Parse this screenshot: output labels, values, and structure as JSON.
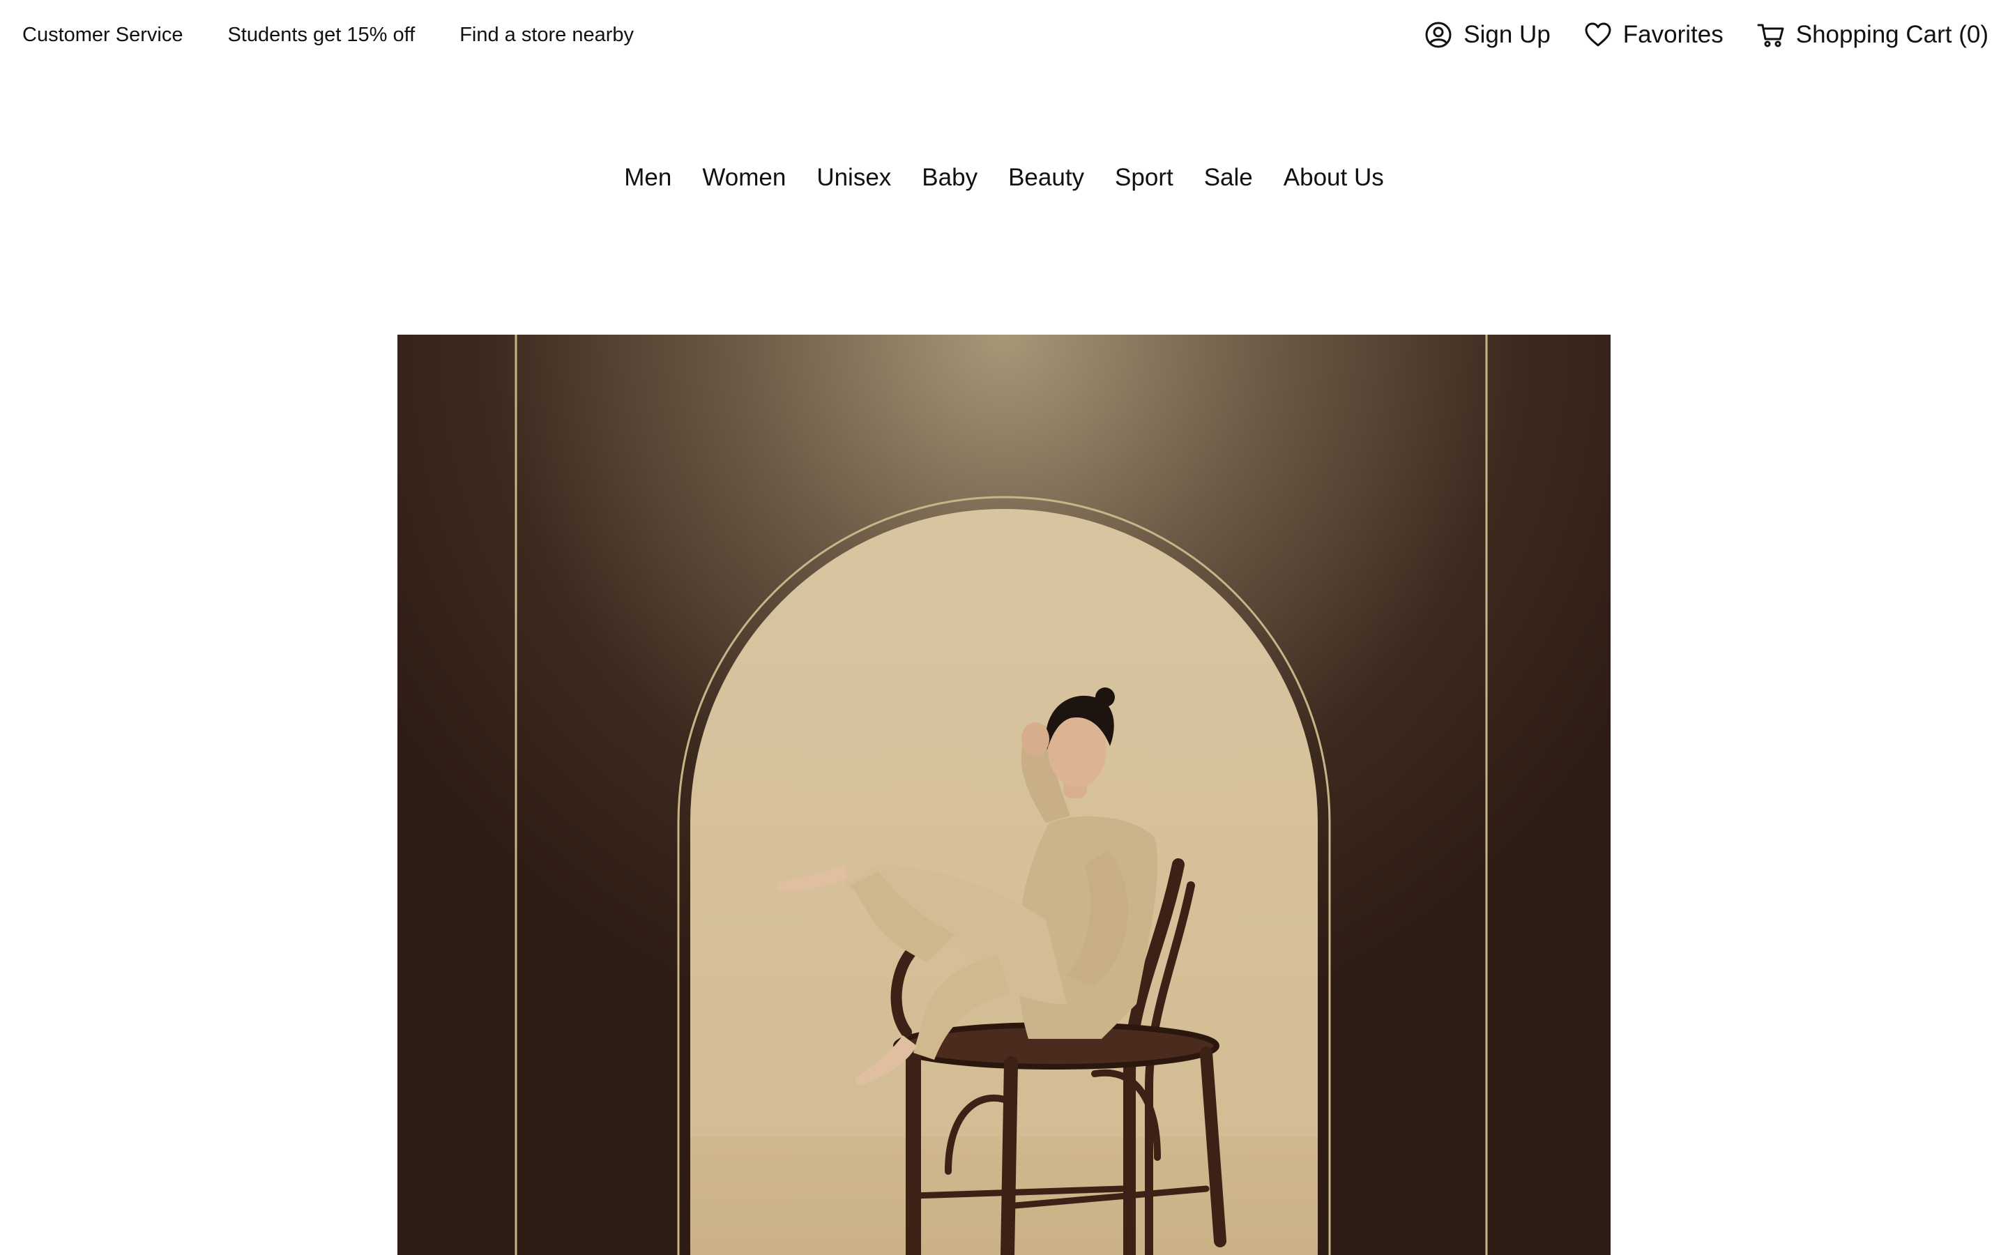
{
  "utility": {
    "links": [
      "Customer Service",
      "Students get 15% off",
      "Find a store nearby"
    ],
    "sign_up": "Sign Up",
    "favorites": "Favorites",
    "cart": "Shopping Cart (0)",
    "icons": {
      "sign_up": "user-circle-icon",
      "favorites": "heart-icon",
      "cart": "shopping-cart-icon"
    }
  },
  "nav": {
    "items": [
      "Men",
      "Women",
      "Unisex",
      "Baby",
      "Beauty",
      "Sport",
      "Sale",
      "About Us"
    ]
  },
  "hero": {
    "alt": "Woman in beige outfit sitting on a rattan chair inside an arched frame",
    "colors": {
      "backdrop_dark": "#2d1c14",
      "spotlight": "#a89878",
      "arch_fill": "#d8c5a0",
      "frame_line": "#c9b48a"
    }
  }
}
